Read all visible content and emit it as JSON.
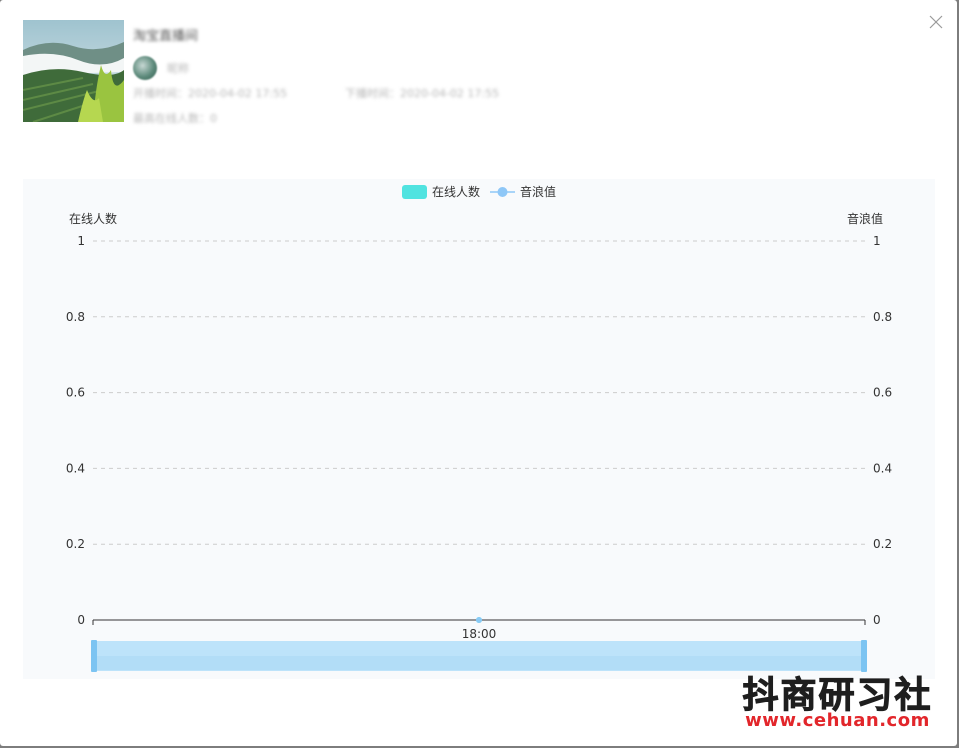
{
  "dialog": {
    "close_icon": "close-icon",
    "room": {
      "title": "淘宝直播间",
      "anchor_name": "昵称",
      "start_time": "开播时间：2020-04-02 17:55",
      "end_time": "下播时间：2020-04-02 17:55",
      "peak_online": "最高在线人数：0"
    }
  },
  "chart_data": {
    "type": "line",
    "legend": [
      {
        "name": "在线人数",
        "symbol": "rect",
        "color": "#50e3e0"
      },
      {
        "name": "音浪值",
        "symbol": "circle",
        "color": "#8ec7f7"
      }
    ],
    "legend_position": "top-center",
    "y_left": {
      "label": "在线人数",
      "min": 0,
      "max": 1,
      "ticks": [
        "1",
        "0.8",
        "0.6",
        "0.4",
        "0.2",
        "0"
      ]
    },
    "y_right": {
      "label": "音浪值",
      "min": 0,
      "max": 1,
      "ticks": [
        "1",
        "0.8",
        "0.6",
        "0.4",
        "0.2",
        "0"
      ]
    },
    "x": {
      "categories": [
        "18:00"
      ]
    },
    "series": [
      {
        "name": "在线人数",
        "values": [
          0
        ]
      },
      {
        "name": "音浪值",
        "values": [
          0
        ]
      }
    ],
    "grid": true,
    "data_zoom": {
      "start": 0,
      "end": 100
    }
  },
  "watermark": {
    "title": "抖商研习社",
    "url": "www.cehuan.com"
  }
}
